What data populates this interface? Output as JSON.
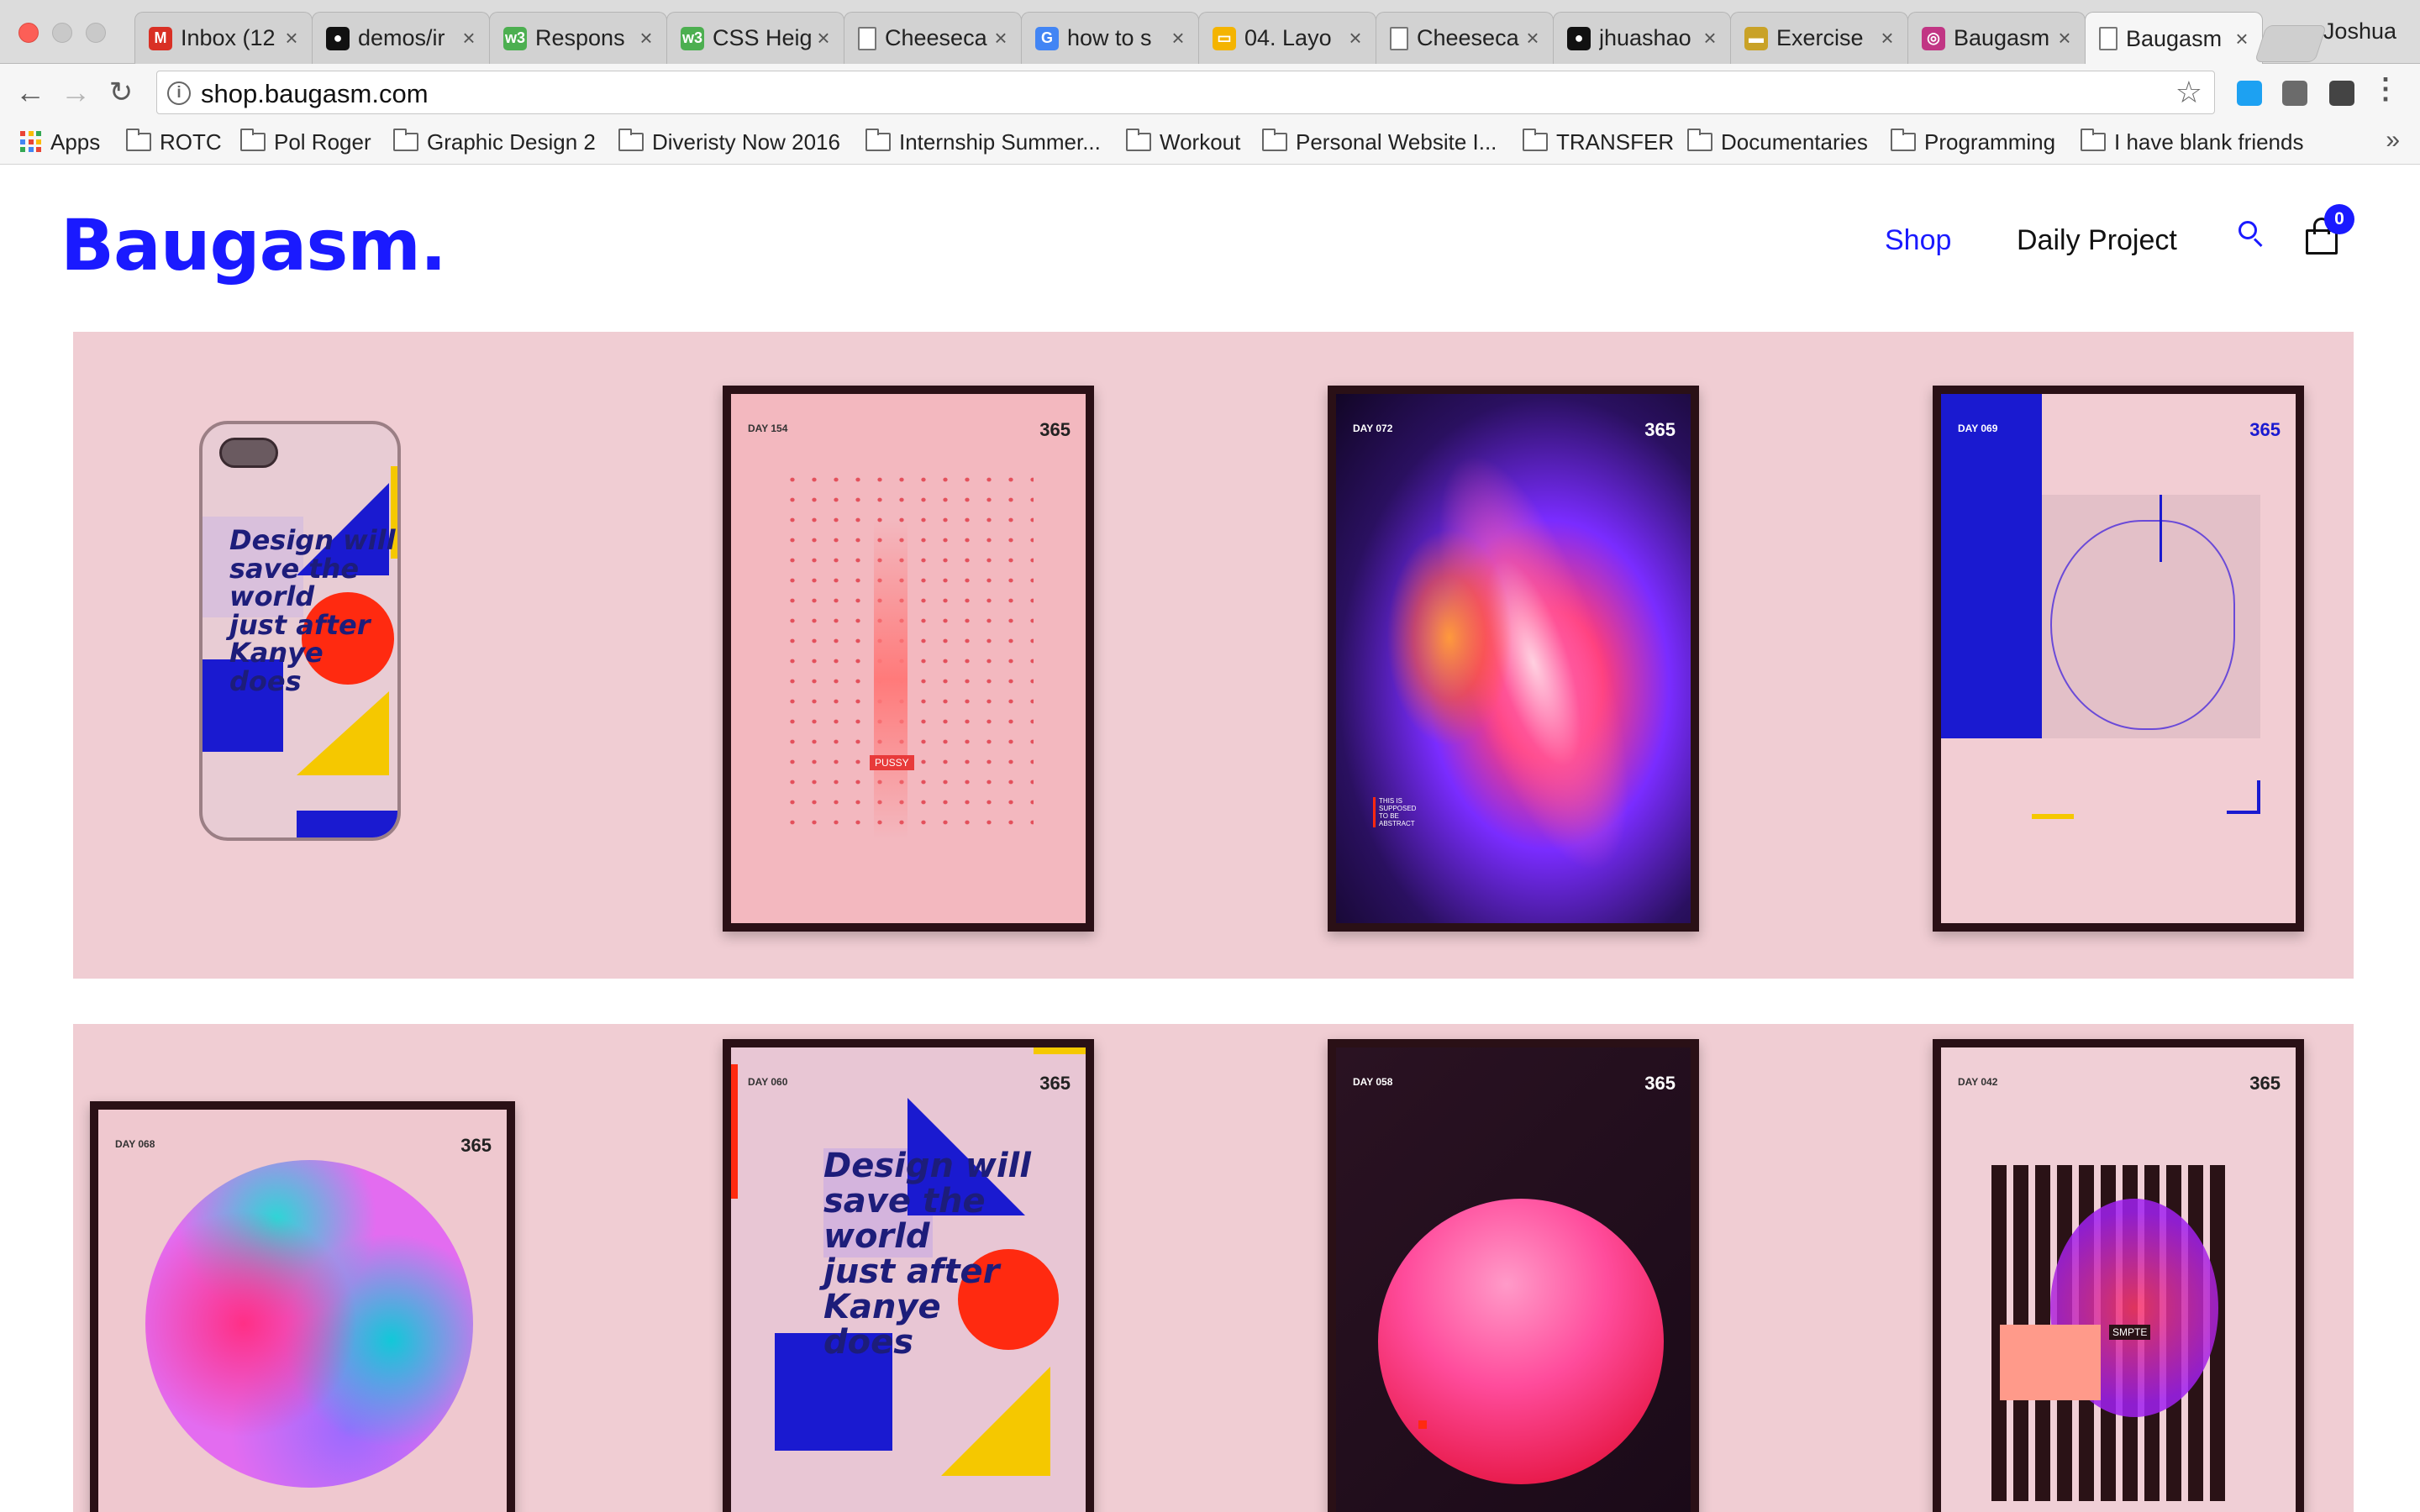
{
  "browser": {
    "tabs": [
      {
        "title": "Inbox (12",
        "icon": "gmail-icon",
        "color": "#d93025",
        "glyph": "M"
      },
      {
        "title": "demos/ir",
        "icon": "github-icon",
        "color": "#111111",
        "glyph": "●"
      },
      {
        "title": "Respons",
        "icon": "w3-icon",
        "color": "#4caf50",
        "glyph": "w3"
      },
      {
        "title": "CSS Heig",
        "icon": "w3-icon",
        "color": "#4caf50",
        "glyph": "w3"
      },
      {
        "title": "Cheeseca",
        "icon": "page-icon",
        "color": "#ffffff",
        "glyph": ""
      },
      {
        "title": "how to s",
        "icon": "google-icon",
        "color": "#4285f4",
        "glyph": "G"
      },
      {
        "title": "04. Layo",
        "icon": "slides-icon",
        "color": "#f4b400",
        "glyph": "▭"
      },
      {
        "title": "Cheeseca",
        "icon": "page-icon",
        "color": "#ffffff",
        "glyph": ""
      },
      {
        "title": "jhuashao",
        "icon": "github-icon",
        "color": "#111111",
        "glyph": "●"
      },
      {
        "title": "Exercise",
        "icon": "laptop-icon",
        "color": "#c9a227",
        "glyph": "▬"
      },
      {
        "title": "Baugasm",
        "icon": "instagram-icon",
        "color": "#c13584",
        "glyph": "◎"
      },
      {
        "title": "Baugasm",
        "icon": "page-icon",
        "color": "#ffffff",
        "glyph": ""
      }
    ],
    "profile_name": "Joshua",
    "url": "shop.baugasm.com",
    "bookmarks": [
      {
        "label": "Apps"
      },
      {
        "label": "ROTC"
      },
      {
        "label": "Pol Roger"
      },
      {
        "label": "Graphic Design 2"
      },
      {
        "label": "Diveristy Now 2016"
      },
      {
        "label": "Internship Summer..."
      },
      {
        "label": "Workout"
      },
      {
        "label": "Personal Website I..."
      },
      {
        "label": "TRANSFER"
      },
      {
        "label": "Documentaries"
      },
      {
        "label": "Programming"
      },
      {
        "label": "I have blank friends"
      }
    ]
  },
  "site": {
    "logo": "Baugasm.",
    "nav": {
      "shop": "Shop",
      "daily_project": "Daily Project"
    },
    "cart_count": "0",
    "accent": "#1a1aff"
  },
  "products": [
    {
      "kind": "phone-case",
      "text": [
        "Design will",
        "save the",
        "world",
        "just after",
        "Kanye",
        "does"
      ]
    },
    {
      "kind": "poster",
      "day": "DAY 154",
      "brand": "365",
      "label": "PUSSY"
    },
    {
      "kind": "poster",
      "day": "DAY 072",
      "brand": "365",
      "caption": "THIS IS SUPPOSED TO BE ABSTRACT"
    },
    {
      "kind": "poster",
      "day": "DAY 069",
      "brand": "365"
    },
    {
      "kind": "poster",
      "day": "DAY 068",
      "brand": "365"
    },
    {
      "kind": "poster",
      "day": "DAY 060",
      "brand": "365",
      "text": [
        "Design will",
        "save the",
        "world",
        "just after",
        "Kanye",
        "does"
      ]
    },
    {
      "kind": "poster",
      "day": "DAY 058",
      "brand": "365"
    },
    {
      "kind": "poster",
      "day": "DAY 042",
      "brand": "365",
      "label": "SMPTE"
    }
  ]
}
